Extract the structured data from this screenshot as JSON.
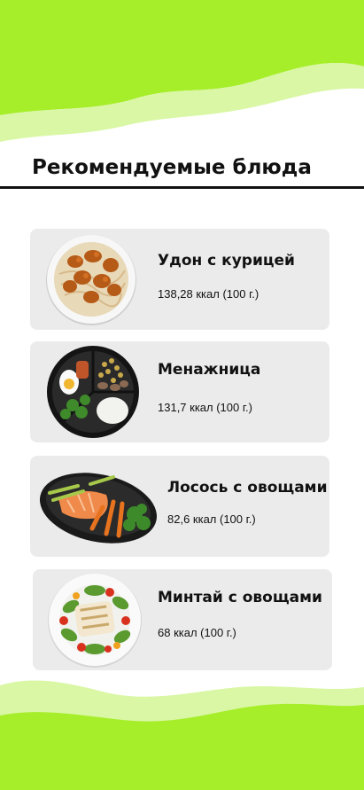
{
  "header": {
    "title": "Рекомендуемые блюда"
  },
  "colors": {
    "accent": "#a6ee2a",
    "accent_light": "#d9f7a4",
    "card_bg": "#ebebeb"
  },
  "dishes": [
    {
      "name": "Удон с курицей",
      "kcal": "138,28 ккал (100 г.)",
      "image": "udon-chicken-bowl"
    },
    {
      "name": "Менажница",
      "kcal": "131,7 ккал (100 г.)",
      "image": "divided-plate"
    },
    {
      "name": "Лосось с овощами",
      "kcal": "82,6 ккал (100 г.)",
      "image": "salmon-vegetables-plate"
    },
    {
      "name": "Минтай с овощами",
      "kcal": "68 ккал (100 г.)",
      "image": "pollock-salad-plate"
    }
  ]
}
